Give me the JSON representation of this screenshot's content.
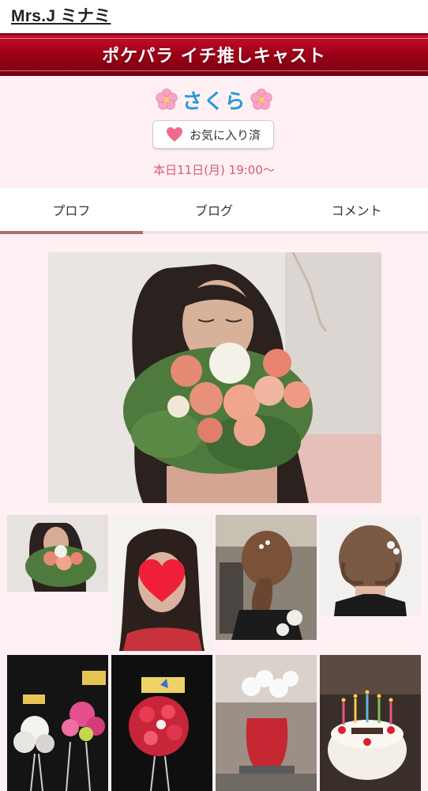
{
  "header": {
    "title": "Mrs.J ミナミ"
  },
  "banner": {
    "title": "ポケパラ イチ推しキャスト"
  },
  "profile": {
    "name": "さくら",
    "favorite_label": "お気に入り済",
    "schedule": "本日11日(月) 19:00〜"
  },
  "tabs": [
    {
      "label": "プロフ",
      "active": true
    },
    {
      "label": "ブログ",
      "active": false
    },
    {
      "label": "コメント",
      "active": false
    }
  ],
  "colors": {
    "banner_red": "#a00018",
    "name_blue": "#2a9ad6",
    "schedule_pink": "#d55a78",
    "background_pink": "#fff0f4",
    "tab_underline": "#b36a72"
  },
  "icons": [
    "cherry-blossom-icon",
    "heart-icon"
  ],
  "gallery": {
    "main_photo": "woman with bouquet of roses covering face",
    "thumbnails": [
      "woman with bouquet",
      "woman with heart over face",
      "updo hairstyle back view",
      "braided updo with pearl pins",
      "flower stand arrangement",
      "red rose flower stand",
      "orchid pot arrangement",
      "birthday cake with candles"
    ]
  }
}
